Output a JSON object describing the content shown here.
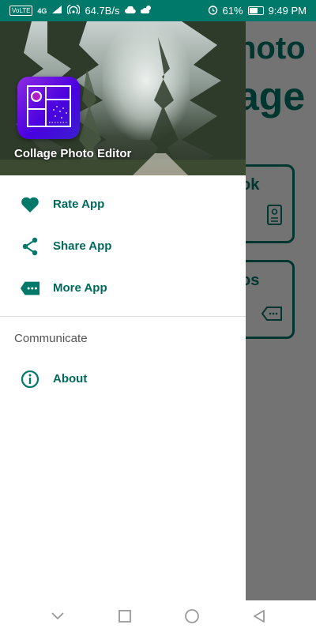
{
  "status_bar": {
    "volte": "VoLTE",
    "network": "4G",
    "speed": "64.7B/s",
    "battery": "61%",
    "time": "9:49 PM"
  },
  "background_app": {
    "title_line1": "hoto",
    "title_line2": "age",
    "card1_label": "ok",
    "card2_label": "os"
  },
  "drawer": {
    "app_name": "Collage Photo Editor",
    "items": [
      {
        "label": "Rate App",
        "icon": "heart-icon"
      },
      {
        "label": "Share App",
        "icon": "share-icon"
      },
      {
        "label": "More App",
        "icon": "more-apps-icon"
      }
    ],
    "section_title": "Communicate",
    "section_items": [
      {
        "label": "About",
        "icon": "info-icon"
      }
    ]
  },
  "colors": {
    "accent": "#00796b",
    "label": "#00695c",
    "status_bar": "#00796b"
  },
  "nav_bar": {
    "icons": [
      "collapse-icon",
      "recents-icon",
      "home-icon",
      "back-icon"
    ]
  }
}
